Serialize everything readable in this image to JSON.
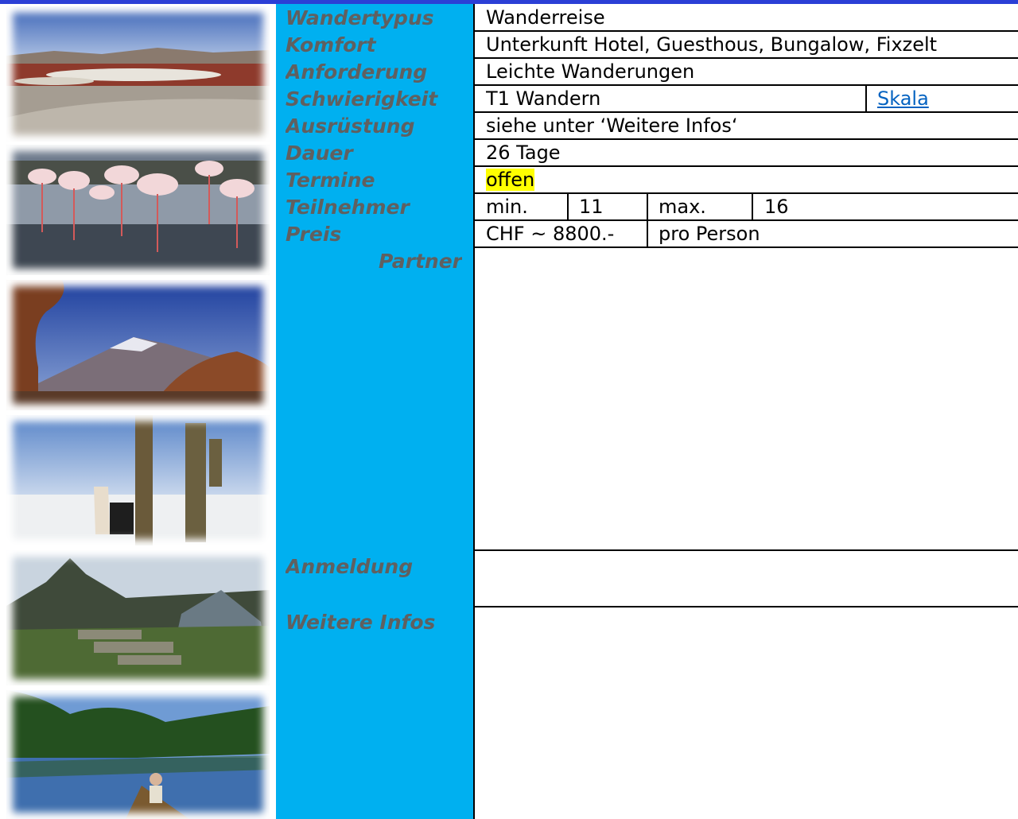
{
  "labels": {
    "wandertypus": "Wandertypus",
    "komfort": "Komfort",
    "anforderung": "Anforderung",
    "schwierigkeit": "Schwierigkeit",
    "ausruestung": "Ausrüstung",
    "dauer": "Dauer",
    "termine": "Termine",
    "teilnehmer": "Teilnehmer",
    "preis": "Preis",
    "partner": "Partner",
    "anmeldung": "Anmeldung",
    "weitere_infos": "Weitere Infos"
  },
  "values": {
    "wandertypus": "Wanderreise",
    "komfort": "Unterkunft Hotel, Guesthous, Bungalow, Fixzelt",
    "anforderung": "Leichte Wanderungen",
    "schwierigkeit": "T1 Wandern",
    "skala_link": "Skala",
    "ausruestung": "siehe unter ‘Weitere Infos‘",
    "dauer": "26 Tage",
    "termine": "offen",
    "teilnehmer_min_label": "min.",
    "teilnehmer_min": "11",
    "teilnehmer_max_label": "max.",
    "teilnehmer_max": "16",
    "preis": "CHF ~ 8800.-",
    "preis_unit": "pro Person"
  },
  "colors": {
    "label_bg": "#00b0f0",
    "label_text": "#606060",
    "highlight": "#ffff00",
    "link": "#0563c1",
    "top_bar": "#2b3fd6"
  }
}
